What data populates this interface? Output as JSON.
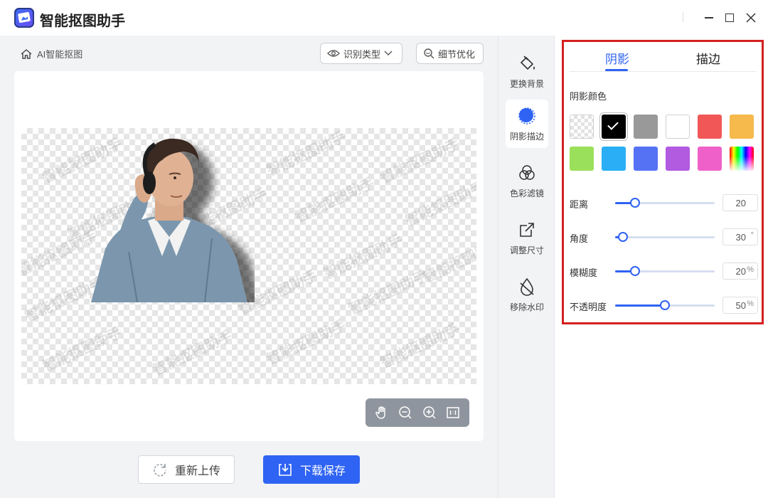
{
  "app": {
    "title": "智能抠图助手"
  },
  "breadcrumb": {
    "label": "AI智能抠图"
  },
  "toolbar": {
    "type_button": "识别类型",
    "detail_button": "细节优化"
  },
  "canvas": {
    "watermark": "智能抠图助手"
  },
  "actions": {
    "reupload": "重新上传",
    "save": "下载保存"
  },
  "tools": [
    {
      "label": "更换背景",
      "icon": "paint-bucket-icon"
    },
    {
      "label": "阴影描边",
      "icon": "shadow-circle-icon",
      "active": true
    },
    {
      "label": "色彩滤镜",
      "icon": "color-filter-icon"
    },
    {
      "label": "调整尺寸",
      "icon": "resize-icon"
    },
    {
      "label": "移除水印",
      "icon": "remove-watermark-icon"
    }
  ],
  "panel": {
    "tabs": [
      {
        "label": "阴影",
        "active": true
      },
      {
        "label": "描边"
      }
    ],
    "color_section_label": "阴影颜色",
    "colors": [
      "transparent",
      "#000000",
      "#999999",
      "#ffffff",
      "#f25757",
      "#f5b94c",
      "#9be05a",
      "#2aaef5",
      "#5572f5",
      "#b25ae0",
      "#ef61c9",
      "rainbow"
    ],
    "selected_color": "#000000",
    "sliders": [
      {
        "label": "距离",
        "value": "20",
        "unit": "",
        "fraction": 0.2
      },
      {
        "label": "角度",
        "value": "30",
        "unit": "°",
        "fraction": 0.08
      },
      {
        "label": "模糊度",
        "value": "20",
        "unit": "%",
        "fraction": 0.2
      },
      {
        "label": "不透明度",
        "value": "50",
        "unit": "%",
        "fraction": 0.5
      }
    ]
  }
}
